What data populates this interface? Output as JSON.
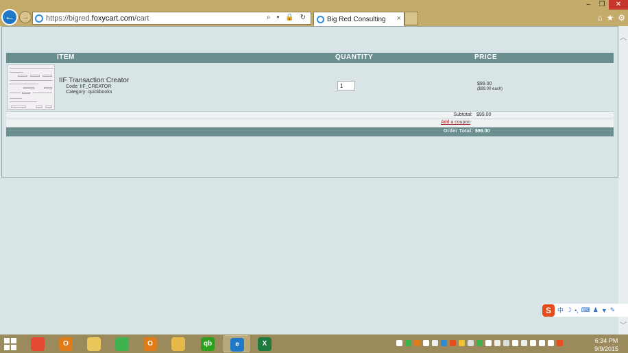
{
  "browser": {
    "url_prefix": "https://bigred.",
    "url_host": "foxycart.com",
    "url_path": "/cart",
    "tab_title": "Big Red Consulting",
    "tab_close": "×",
    "back_glyph": "←",
    "forward_glyph": "→",
    "address_tools": "⌕ ▾ 🔒 ↻",
    "window_controls": {
      "minimize": "‒",
      "restore": "❐",
      "close": "✕"
    },
    "toolbar_icons": {
      "home": "⌂",
      "favorites": "★",
      "settings": "⚙"
    }
  },
  "cart": {
    "headers": {
      "item": "ITEM",
      "quantity": "QUANTITY",
      "price": "PRICE"
    },
    "item": {
      "name": "IIF Transaction Creator",
      "code": "Code: IIF_CREATOR",
      "category": "Category: quickbooks",
      "quantity": "1",
      "price": "$99.00",
      "price_each": "($99.00 each)"
    },
    "subtotal_label": "Subtotal:",
    "subtotal_value": "$99.00",
    "coupon_link": "Add a coupon",
    "total_label": "Order Total:",
    "total_value": "$99.00"
  },
  "ime": {
    "logo": "S",
    "mode": "中"
  },
  "taskbar": {
    "time": "6:34 PM",
    "date": "9/9/2015",
    "apps": [
      {
        "name": "chrome",
        "label": "",
        "color": "#e34a2f"
      },
      {
        "name": "outlook",
        "label": "O",
        "color": "#e07b1a"
      },
      {
        "name": "notes",
        "label": "",
        "color": "#e9c75a"
      },
      {
        "name": "wechat",
        "label": "",
        "color": "#3fb34f"
      },
      {
        "name": "outlook-2",
        "label": "O",
        "color": "#e07b1a"
      },
      {
        "name": "file-explorer",
        "label": "",
        "color": "#e6b94a"
      },
      {
        "name": "quickbooks",
        "label": "qb",
        "color": "#2ca01c"
      },
      {
        "name": "internet-explorer",
        "label": "e",
        "color": "#1f78c8"
      },
      {
        "name": "excel",
        "label": "X",
        "color": "#1f7a3e"
      }
    ]
  },
  "colors": {
    "header_bar": "#6b8f8f",
    "page_background": "#d9e4e6",
    "coupon_link": "#9b2020",
    "chrome": "#c5ab6a",
    "taskbar": "#9a8a5c"
  }
}
